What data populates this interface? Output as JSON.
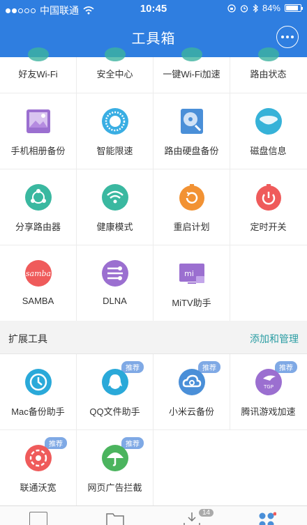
{
  "status": {
    "carrier": "中国联通",
    "time": "10:45",
    "battery": "84%",
    "battery_level": 0.84
  },
  "header": {
    "title": "工具箱"
  },
  "tools_row0": [
    "好友Wi-Fi",
    "安全中心",
    "一键Wi-Fi加速",
    "路由状态"
  ],
  "tools": [
    {
      "label": "手机相册备份",
      "icon": "photo-album-icon",
      "color": "#9b6fd0"
    },
    {
      "label": "智能限速",
      "icon": "speed-limit-icon",
      "color": "#3aaee3"
    },
    {
      "label": "路由硬盘备份",
      "icon": "hard-disk-backup-icon",
      "color": "#4a8fd8"
    },
    {
      "label": "磁盘信息",
      "icon": "disk-info-icon",
      "color": "#36b2d8"
    },
    {
      "label": "分享路由器",
      "icon": "share-router-icon",
      "color": "#3ab8a0"
    },
    {
      "label": "健康模式",
      "icon": "wifi-health-icon",
      "color": "#3ab8a0"
    },
    {
      "label": "重启计划",
      "icon": "restart-plan-icon",
      "color": "#f29233"
    },
    {
      "label": "定时开关",
      "icon": "timer-switch-icon",
      "color": "#ef5b5b"
    },
    {
      "label": "SAMBA",
      "icon": "samba-icon",
      "color": "#ef5b5b"
    },
    {
      "label": "DLNA",
      "icon": "dlna-icon",
      "color": "#9b6fd0"
    },
    {
      "label": "MiTV助手",
      "icon": "mitv-icon",
      "color": "#9b6fd0"
    },
    {
      "label": "",
      "icon": "",
      "color": ""
    }
  ],
  "ext": {
    "title": "扩展工具",
    "manage": "添加和管理"
  },
  "ext_tools": [
    {
      "label": "Mac备份助手",
      "icon": "mac-backup-icon",
      "color": "#2aa9d9",
      "badge": ""
    },
    {
      "label": "QQ文件助手",
      "icon": "qq-icon",
      "color": "#2aa9d9",
      "badge": "推荐"
    },
    {
      "label": "小米云备份",
      "icon": "cloud-backup-icon",
      "color": "#4a8fd8",
      "badge": "推荐"
    },
    {
      "label": "腾讯游戏加速",
      "icon": "tgp-icon",
      "color": "#9b6fd0",
      "badge": "推荐"
    },
    {
      "label": "联通沃宽",
      "icon": "unicom-icon",
      "color": "#ef5b5b",
      "badge": "推荐"
    },
    {
      "label": "网页广告拦截",
      "icon": "umbrella-icon",
      "color": "#4bb45e",
      "badge": "推荐"
    },
    {
      "label": "",
      "icon": "",
      "color": "",
      "badge": ""
    },
    {
      "label": "",
      "icon": "",
      "color": "",
      "badge": ""
    }
  ],
  "tabbar": {
    "download_count": "14"
  },
  "samba_text": "samba",
  "mitv_text": "mi",
  "tgp_text": "TGP"
}
